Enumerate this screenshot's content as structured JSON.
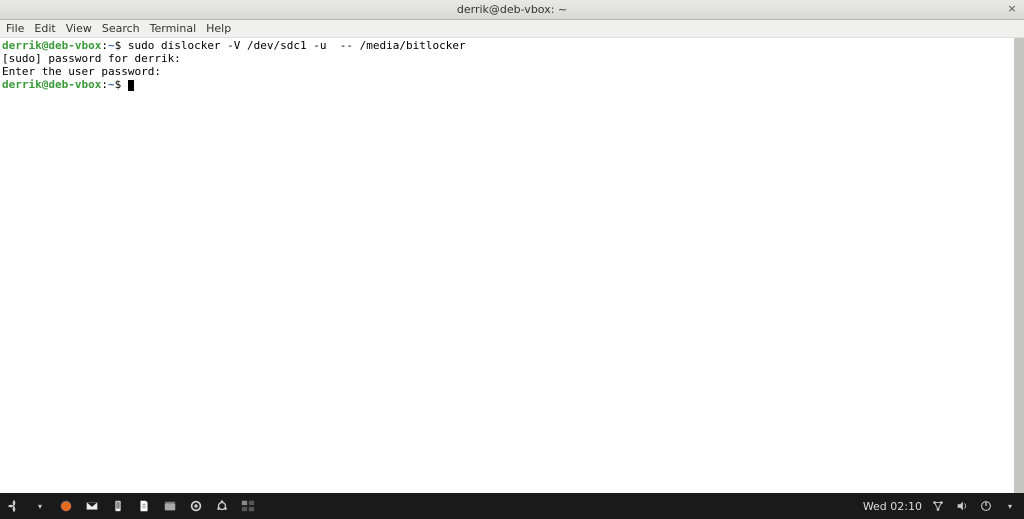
{
  "titlebar": {
    "title": "derrik@deb-vbox: ~"
  },
  "menubar": {
    "items": [
      "File",
      "Edit",
      "View",
      "Search",
      "Terminal",
      "Help"
    ]
  },
  "terminal": {
    "prompt1_user": "derrik@deb-vbox",
    "prompt1_sep": ":",
    "prompt1_path": "~",
    "prompt1_sym": "$ ",
    "cmd1": "sudo dislocker -V /dev/sdc1 -u  -- /media/bitlocker",
    "line2": "[sudo] password for derrik:",
    "line3": "Enter the user password:",
    "prompt2_user": "derrik@deb-vbox",
    "prompt2_sep": ":",
    "prompt2_path": "~",
    "prompt2_sym": "$ "
  },
  "taskbar": {
    "clock": "Wed 02:10"
  }
}
